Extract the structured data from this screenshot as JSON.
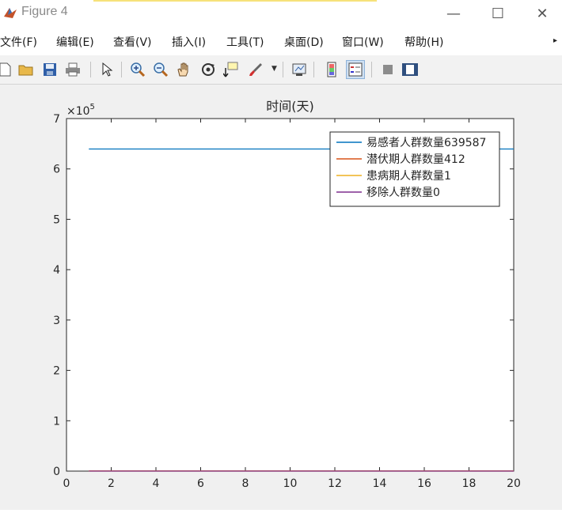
{
  "window": {
    "title": "Figure 4",
    "minimize_glyph": "—",
    "maximize_glyph": "☐",
    "close_glyph": "✕"
  },
  "menu": {
    "items": [
      "文件(F)",
      "编辑(E)",
      "查看(V)",
      "插入(I)",
      "工具(T)",
      "桌面(D)",
      "窗口(W)",
      "帮助(H)"
    ]
  },
  "toolbar": {
    "icons": [
      "new-figure-icon",
      "open-file-icon",
      "save-icon",
      "print-icon",
      "select-pointer-icon",
      "zoom-in-icon",
      "zoom-out-icon",
      "pan-hand-icon",
      "rotate-3d-icon",
      "data-cursor-icon",
      "brush-icon",
      "link-plot-icon",
      "colorbar-icon",
      "legend-icon",
      "hide-plot-tools-icon",
      "show-plot-tools-icon"
    ]
  },
  "colors": {
    "series": [
      "#0072bd",
      "#d95319",
      "#edb120",
      "#7e2f8e"
    ],
    "figure_bg": "#f0f0f0",
    "axes_bg": "#ffffff"
  },
  "chart_data": {
    "type": "line",
    "title": "时间(天)",
    "xlabel": "",
    "ylabel": "",
    "y_exponent_label": "×10",
    "y_exponent": "5",
    "xlim": [
      0,
      20
    ],
    "ylim": [
      0,
      700000
    ],
    "x_ticks": [
      0,
      2,
      4,
      6,
      8,
      10,
      12,
      14,
      16,
      18,
      20
    ],
    "y_ticks": [
      0,
      100000,
      200000,
      300000,
      400000,
      500000,
      600000,
      700000
    ],
    "y_tick_labels": [
      "0",
      "1",
      "2",
      "3",
      "4",
      "5",
      "6",
      "7"
    ],
    "grid": false,
    "legend_position": "top-right",
    "series": [
      {
        "name": "易感者人群数量639587",
        "x": [
          1,
          20
        ],
        "y": [
          639587,
          639587
        ]
      },
      {
        "name": "潜伏期人群数量412",
        "x": [
          1,
          20
        ],
        "y": [
          412,
          412
        ]
      },
      {
        "name": "患病期人群数量1",
        "x": [
          1,
          20
        ],
        "y": [
          1,
          1
        ]
      },
      {
        "name": "移除人群数量0",
        "x": [
          1,
          20
        ],
        "y": [
          0,
          0
        ]
      }
    ]
  }
}
